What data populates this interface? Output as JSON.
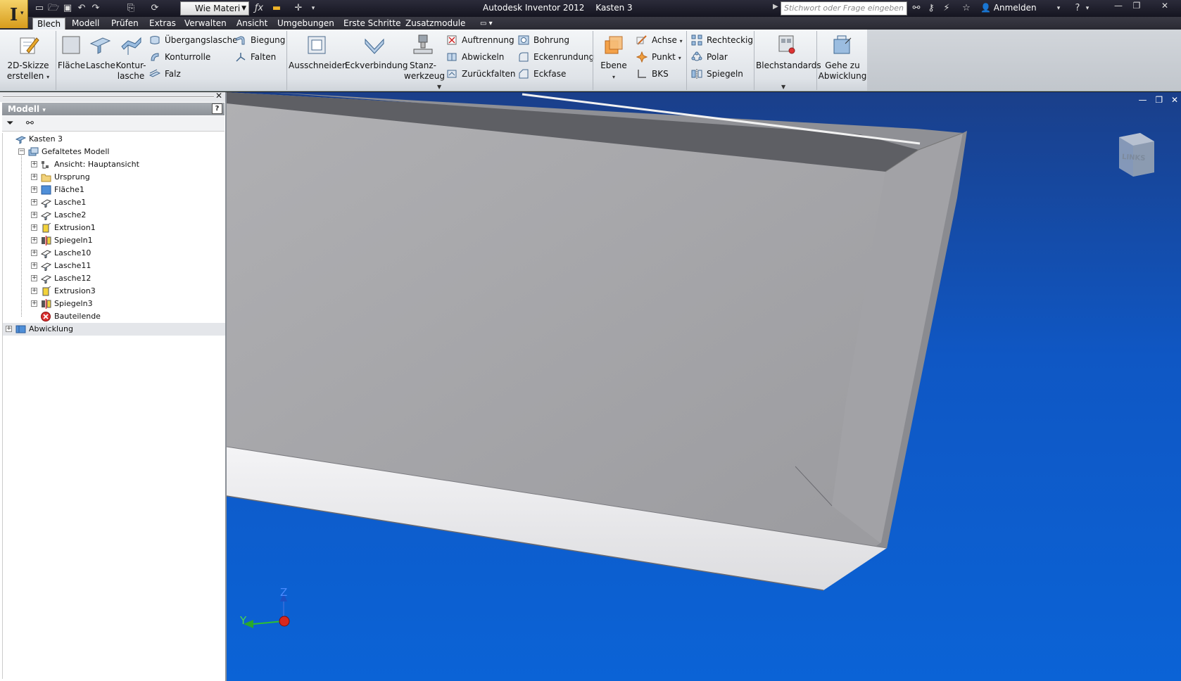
{
  "titlebar": {
    "material": "Wie Materi",
    "app_name": "Autodesk Inventor 2012",
    "document": "Kasten 3",
    "search_placeholder": "Stichwort oder Frage eingeben",
    "login": "Anmelden"
  },
  "tabs": [
    "Blech",
    "Modell",
    "Prüfen",
    "Extras",
    "Verwalten",
    "Ansicht",
    "Umgebungen",
    "Erste Schritte",
    "Zusatzmodule"
  ],
  "active_tab": "Blech",
  "ribbon": {
    "sketch": "2D-Skizze\nerstellen",
    "flaeche": "Fläche",
    "lasche": "Lasche",
    "konturlasche": "Kontur-\nlasche",
    "uebergangslasche": "Übergangslasche",
    "konturrolle": "Konturrolle",
    "falz": "Falz",
    "biegung": "Biegung",
    "falten": "Falten",
    "ausschneiden": "Ausschneiden",
    "eckverbindung": "Eckverbindung",
    "stanzwerkzeug": "Stanz-\nwerkzeug",
    "auftrennung": "Auftrennung",
    "abwickeln": "Abwickeln",
    "zurueckfalten": "Zurückfalten",
    "bohrung": "Bohrung",
    "eckenrundung": "Eckenrundung",
    "eckfase": "Eckfase",
    "ebene": "Ebene",
    "achse": "Achse",
    "punkt": "Punkt",
    "bks": "BKS",
    "rechteckig": "Rechteckig",
    "polar": "Polar",
    "spiegeln": "Spiegeln",
    "blechstandards": "Blechstandards",
    "gehe_zu_abwicklung": "Gehe zu\nAbwicklung"
  },
  "browser": {
    "title": "Modell",
    "help": "?",
    "nodes": [
      {
        "label": "Kasten 3",
        "icon": "sheetmetal-part-icon"
      },
      {
        "label": "Gefaltetes Modell",
        "icon": "folded-model-icon"
      },
      {
        "label": "Ansicht: Hauptansicht",
        "icon": "view-icon"
      },
      {
        "label": "Ursprung",
        "icon": "folder-icon"
      },
      {
        "label": "Fläche1",
        "icon": "face-feature-icon"
      },
      {
        "label": "Lasche1",
        "icon": "flange-icon"
      },
      {
        "label": "Lasche2",
        "icon": "flange-icon"
      },
      {
        "label": "Extrusion1",
        "icon": "extrusion-icon"
      },
      {
        "label": "Spiegeln1",
        "icon": "mirror-icon"
      },
      {
        "label": "Lasche10",
        "icon": "flange-icon"
      },
      {
        "label": "Lasche11",
        "icon": "flange-icon"
      },
      {
        "label": "Lasche12",
        "icon": "flange-icon"
      },
      {
        "label": "Extrusion3",
        "icon": "extrusion-icon"
      },
      {
        "label": "Spiegeln3",
        "icon": "mirror-icon"
      },
      {
        "label": "Bauteilende",
        "icon": "end-of-part-icon"
      },
      {
        "label": "Abwicklung",
        "icon": "flat-pattern-icon"
      }
    ]
  },
  "viewport": {
    "viewcube_label": "LINKS",
    "axis_z": "Z",
    "axis_y": "Y"
  },
  "colors": {
    "accent": "#f0b428",
    "viewport_top": "#1a3f8a",
    "viewport_bottom": "#0b63d6",
    "part_face": "#a8a8aa"
  }
}
